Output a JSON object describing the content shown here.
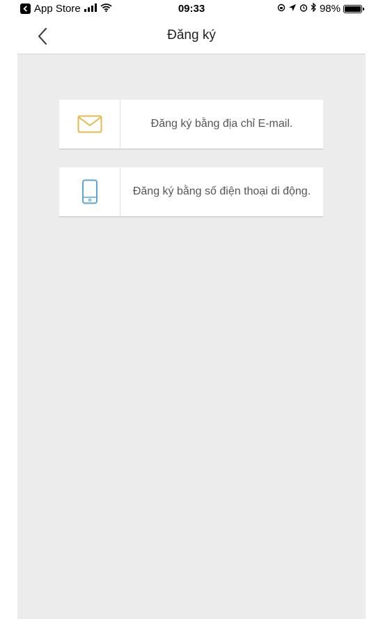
{
  "status_bar": {
    "back_app": "App Store",
    "time": "09:33",
    "battery": "98%",
    "battery_level": 0.98
  },
  "nav": {
    "title": "Đăng ký",
    "back_icon": "chevron-left-icon"
  },
  "options": [
    {
      "label": "Đăng ký bằng địa chỉ E-mail.",
      "icon": "mail-icon",
      "icon_color": "#e8b84a"
    },
    {
      "label": "Đăng ký bằng số điện thoại di động.",
      "icon": "mobile-phone-icon",
      "icon_color": "#5aa5d6"
    }
  ],
  "colors": {
    "content_background": "#ececec",
    "card_background": "#ffffff",
    "text": "#555555"
  }
}
